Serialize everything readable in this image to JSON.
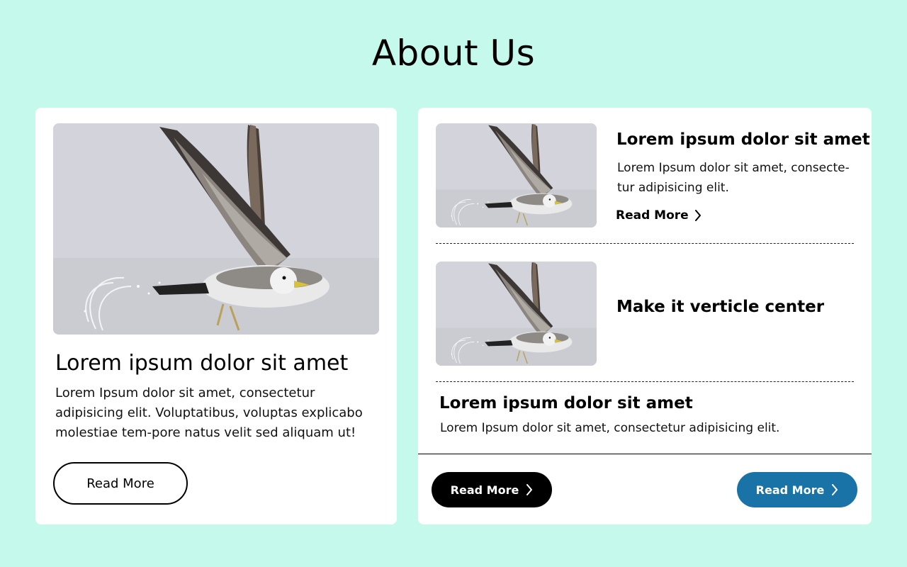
{
  "page": {
    "title": "About Us",
    "background": "#c4f9ec"
  },
  "left_card": {
    "image_icon": "seagull-photo",
    "title": "Lorem ipsum dolor sit amet",
    "text": "Lorem Ipsum dolor sit amet, consectetur adipisicing elit. Voluptatibus, voluptas explicabo molestiae tem-pore natus velit sed aliquam ut!",
    "button_label": "Read More"
  },
  "right_card": {
    "items": [
      {
        "image_icon": "seagull-photo",
        "title": "Lorem ipsum dolor sit amet",
        "text": "Lorem Ipsum dolor sit amet, consecte-tur adipisicing elit.",
        "link_label": "Read More",
        "link_icon": "chevron-right-icon"
      },
      {
        "image_icon": "seagull-photo",
        "title": "Make it verticle center"
      },
      {
        "title": "Lorem ipsum dolor sit amet",
        "text": "Lorem Ipsum dolor sit amet, consectetur adipisicing elit."
      }
    ],
    "footer": {
      "dark_button_label": "Read More",
      "blue_button_label": "Read More",
      "dark_color": "#000000",
      "blue_color": "#1a73a6"
    }
  }
}
